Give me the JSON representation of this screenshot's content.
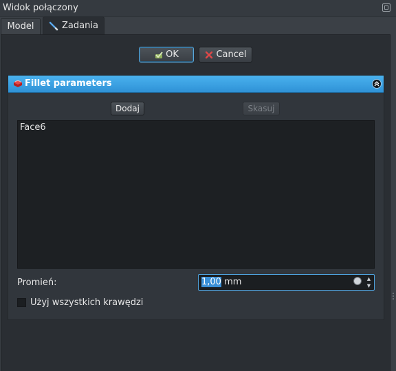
{
  "window": {
    "title": "Widok połączony"
  },
  "tabs": [
    {
      "label": "Model",
      "active": false
    },
    {
      "label": "Zadania",
      "active": true,
      "icon": "pencil-icon"
    }
  ],
  "dialog": {
    "ok_label": "OK",
    "cancel_label": "Cancel"
  },
  "fillet": {
    "title": "Fillet parameters",
    "add_label": "Dodaj",
    "remove_label": "Skasuj",
    "faces": [
      "Face6"
    ],
    "radius_label": "Promień:",
    "radius_value": "1,00",
    "radius_unit": "mm",
    "use_all_edges_label": "Użyj wszystkich krawędzi",
    "use_all_edges_checked": false
  },
  "colors": {
    "accent": "#3a8fd6",
    "header": "#2f92d6",
    "background": "#2a2e33"
  }
}
